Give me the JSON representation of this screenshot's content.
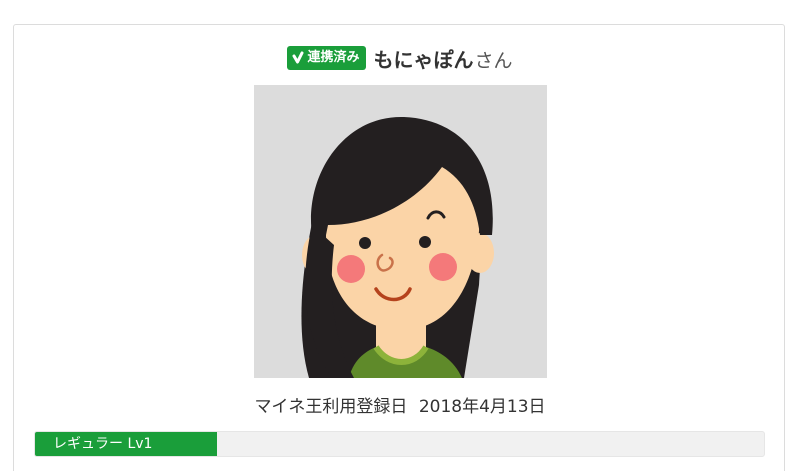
{
  "profile": {
    "badge_label": "連携済み",
    "badge_icon": "check-leaf-icon",
    "username": "もにゃぽん",
    "honorific": "さん",
    "avatar": "avatar-woman-illustration"
  },
  "registration": {
    "label": "マイネ王利用登録日",
    "date": "2018年4月13日"
  },
  "level": {
    "label": "レギュラー Lv1",
    "progress_fraction": 0.25
  },
  "colors": {
    "accent_green": "#1a9e3a",
    "avatar_background": "#dcdcdc",
    "bar_track": "#f1f1f1"
  }
}
